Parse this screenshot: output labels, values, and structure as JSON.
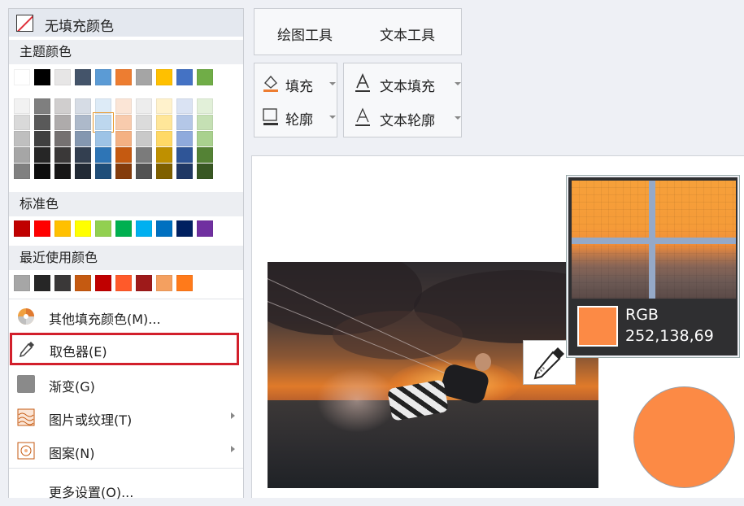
{
  "menu": {
    "no_fill_label": "无填充颜色",
    "theme_colors_label": "主题颜色",
    "theme_colors": [
      "#ffffff",
      "#000000",
      "#e7e6e6",
      "#44546a",
      "#5b9bd5",
      "#ed7d31",
      "#a5a5a5",
      "#ffc000",
      "#4472c4",
      "#70ad47"
    ],
    "theme_shades": [
      [
        "#f2f2f2",
        "#d9d9d9",
        "#bfbfbf",
        "#a6a6a6",
        "#808080"
      ],
      [
        "#7f7f7f",
        "#595959",
        "#404040",
        "#262626",
        "#0d0d0d"
      ],
      [
        "#d0cece",
        "#aeabab",
        "#757171",
        "#3a3838",
        "#171616"
      ],
      [
        "#d6dce5",
        "#adb9ca",
        "#8497b0",
        "#333f50",
        "#222a35"
      ],
      [
        "#ddebf7",
        "#bdd7ee",
        "#9dc3e6",
        "#2e75b6",
        "#1f4e79"
      ],
      [
        "#fbe5d6",
        "#f8cbad",
        "#f4b183",
        "#c55a11",
        "#843c0c"
      ],
      [
        "#ededed",
        "#dbdbdb",
        "#c9c9c9",
        "#7b7b7b",
        "#525252"
      ],
      [
        "#fff2cc",
        "#ffe699",
        "#ffd966",
        "#bf9000",
        "#7f6000"
      ],
      [
        "#dae3f3",
        "#b4c7e7",
        "#8faadc",
        "#2f5597",
        "#203864"
      ],
      [
        "#e2f0d9",
        "#c5e0b4",
        "#a9d18e",
        "#548235",
        "#385723"
      ]
    ],
    "standard_colors_label": "标准色",
    "standard_colors": [
      "#c00000",
      "#ff0000",
      "#ffc000",
      "#ffff00",
      "#92d050",
      "#00b050",
      "#00b0f0",
      "#0070c0",
      "#002060",
      "#7030a0"
    ],
    "recent_colors_label": "最近使用颜色",
    "recent_colors": [
      "#a6a6a6",
      "#262626",
      "#3a3838",
      "#c55a11",
      "#c00000",
      "#ff5a2a",
      "#9e1a1a",
      "#f4a060",
      "#ff7a1a"
    ],
    "items": {
      "more_fill": "其他填充颜色(M)...",
      "eyedropper": "取色器(E)",
      "gradient": "渐变(G)",
      "picture_texture": "图片或纹理(T)",
      "pattern": "图案(N)",
      "more_settings": "更多设置(O)..."
    }
  },
  "toolbar": {
    "tabs": [
      "绘图工具",
      "文本工具"
    ],
    "fill": "填充",
    "outline": "轮廓",
    "text_fill": "文本填充",
    "text_outline": "文本轮廓"
  },
  "magnifier": {
    "label": "RGB",
    "value": "252,138,69",
    "color": "#fc8a45"
  },
  "shape": {
    "fill": "#fc8a45"
  }
}
